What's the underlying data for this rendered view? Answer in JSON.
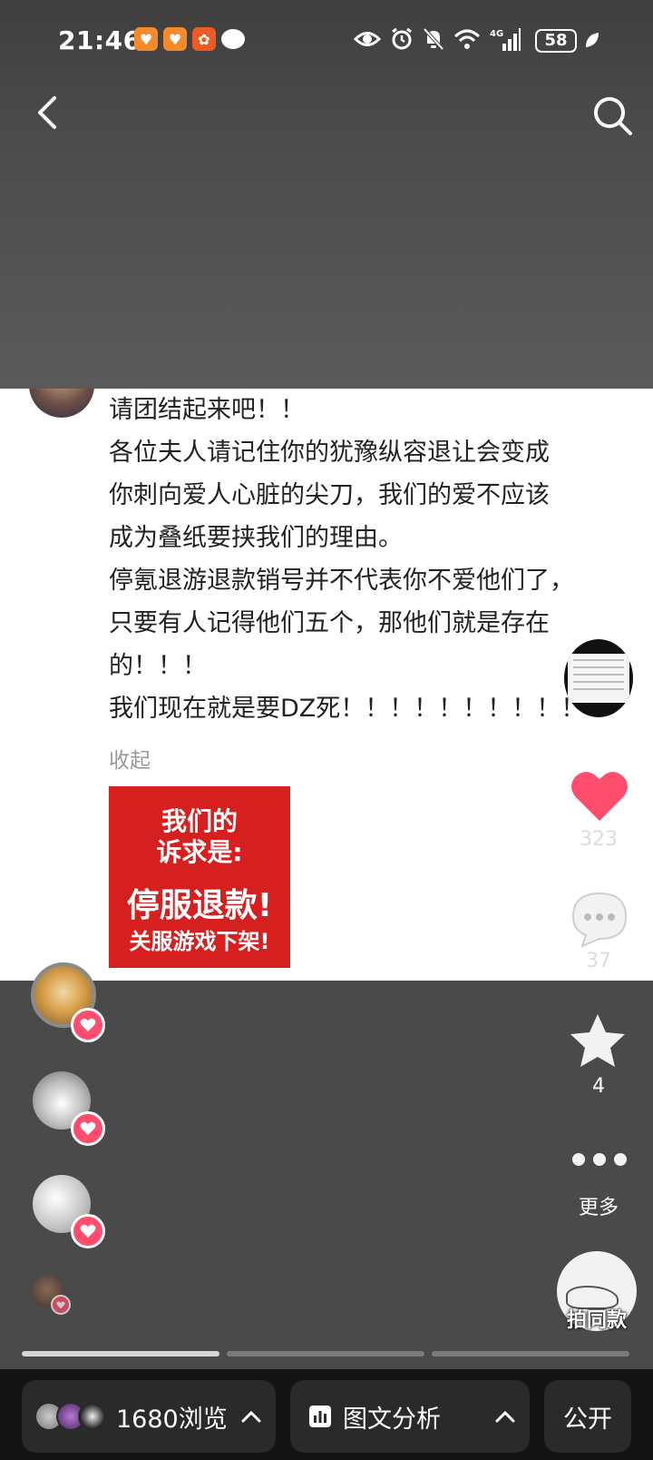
{
  "status_bar": {
    "time": "21:46",
    "battery": "58",
    "network": "4G"
  },
  "post": {
    "lines": [
      "请团结起来吧！！",
      "各位夫人请记住你的犹豫纵容退让会变成",
      "你刺向爱人心脏的尖刀，我们的爱不应该",
      "成为叠纸要挟我们的理由。",
      "停氪退游退款销号并不代表你不爱他们了，",
      "只要有人记得他们五个，那他们就是存在",
      "的！！！",
      "我们现在就是要DZ死！！！！！！！！！！"
    ],
    "collapse_label": "收起"
  },
  "demand_image": {
    "line1": "我们的",
    "line2": "诉求是:",
    "line3": "停服退款!",
    "line4": "关服游戏下架!"
  },
  "actions": {
    "like_count": "323",
    "comment_count": "37",
    "favorite_count": "4",
    "more_label": "更多",
    "same_style_label": "拍同款"
  },
  "bottom_bar": {
    "views_label": "1680浏览",
    "analysis_label": "图文分析",
    "public_label": "公开"
  },
  "progress": {
    "total_pages": 3,
    "current_page": 1
  },
  "colors": {
    "like": "#ff4d6d",
    "demand_bg": "#d61f1f",
    "bottom_bar": "#141414"
  }
}
